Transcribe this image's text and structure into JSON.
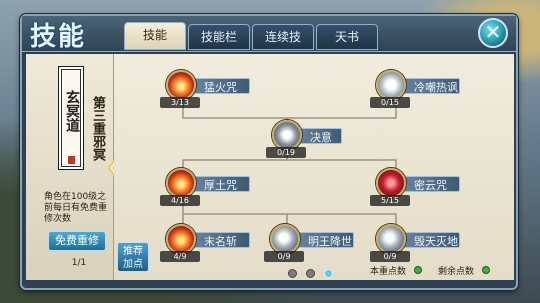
{
  "header": {
    "title": "技能",
    "tabs": [
      {
        "label": "技能"
      },
      {
        "label": "技能栏"
      },
      {
        "label": "连续技"
      },
      {
        "label": "天书"
      }
    ],
    "close_label": "✕"
  },
  "left_panel": {
    "scroll_text": "玄冥道",
    "tier_title": "第三重邪冥",
    "note": "角色在100级之前每日有免费重修次数",
    "reset_label": "免费重修",
    "page_count": "1/1"
  },
  "skills": [
    {
      "name": "猛火咒",
      "level": "3/13",
      "style": "fire"
    },
    {
      "name": "冷嘲热讽",
      "level": "0/15",
      "style": "white"
    },
    {
      "name": "决意",
      "level": "0/19",
      "style": "grey"
    },
    {
      "name": "厚土咒",
      "level": "4/16",
      "style": "fire"
    },
    {
      "name": "密云咒",
      "level": "5/15",
      "style": "red"
    },
    {
      "name": "末名斩",
      "level": "4/9",
      "style": "fire"
    },
    {
      "name": "明王降世",
      "level": "0/9",
      "style": "orb"
    },
    {
      "name": "毁天灭地",
      "level": "0/9",
      "style": "orb"
    }
  ],
  "footer": {
    "recommend_label_1": "推荐",
    "recommend_label_2": "加点",
    "reset_points_label": "本重点数",
    "remaining_points_label": "剩余点数",
    "page_dots": [
      "off",
      "off",
      "on"
    ]
  }
}
